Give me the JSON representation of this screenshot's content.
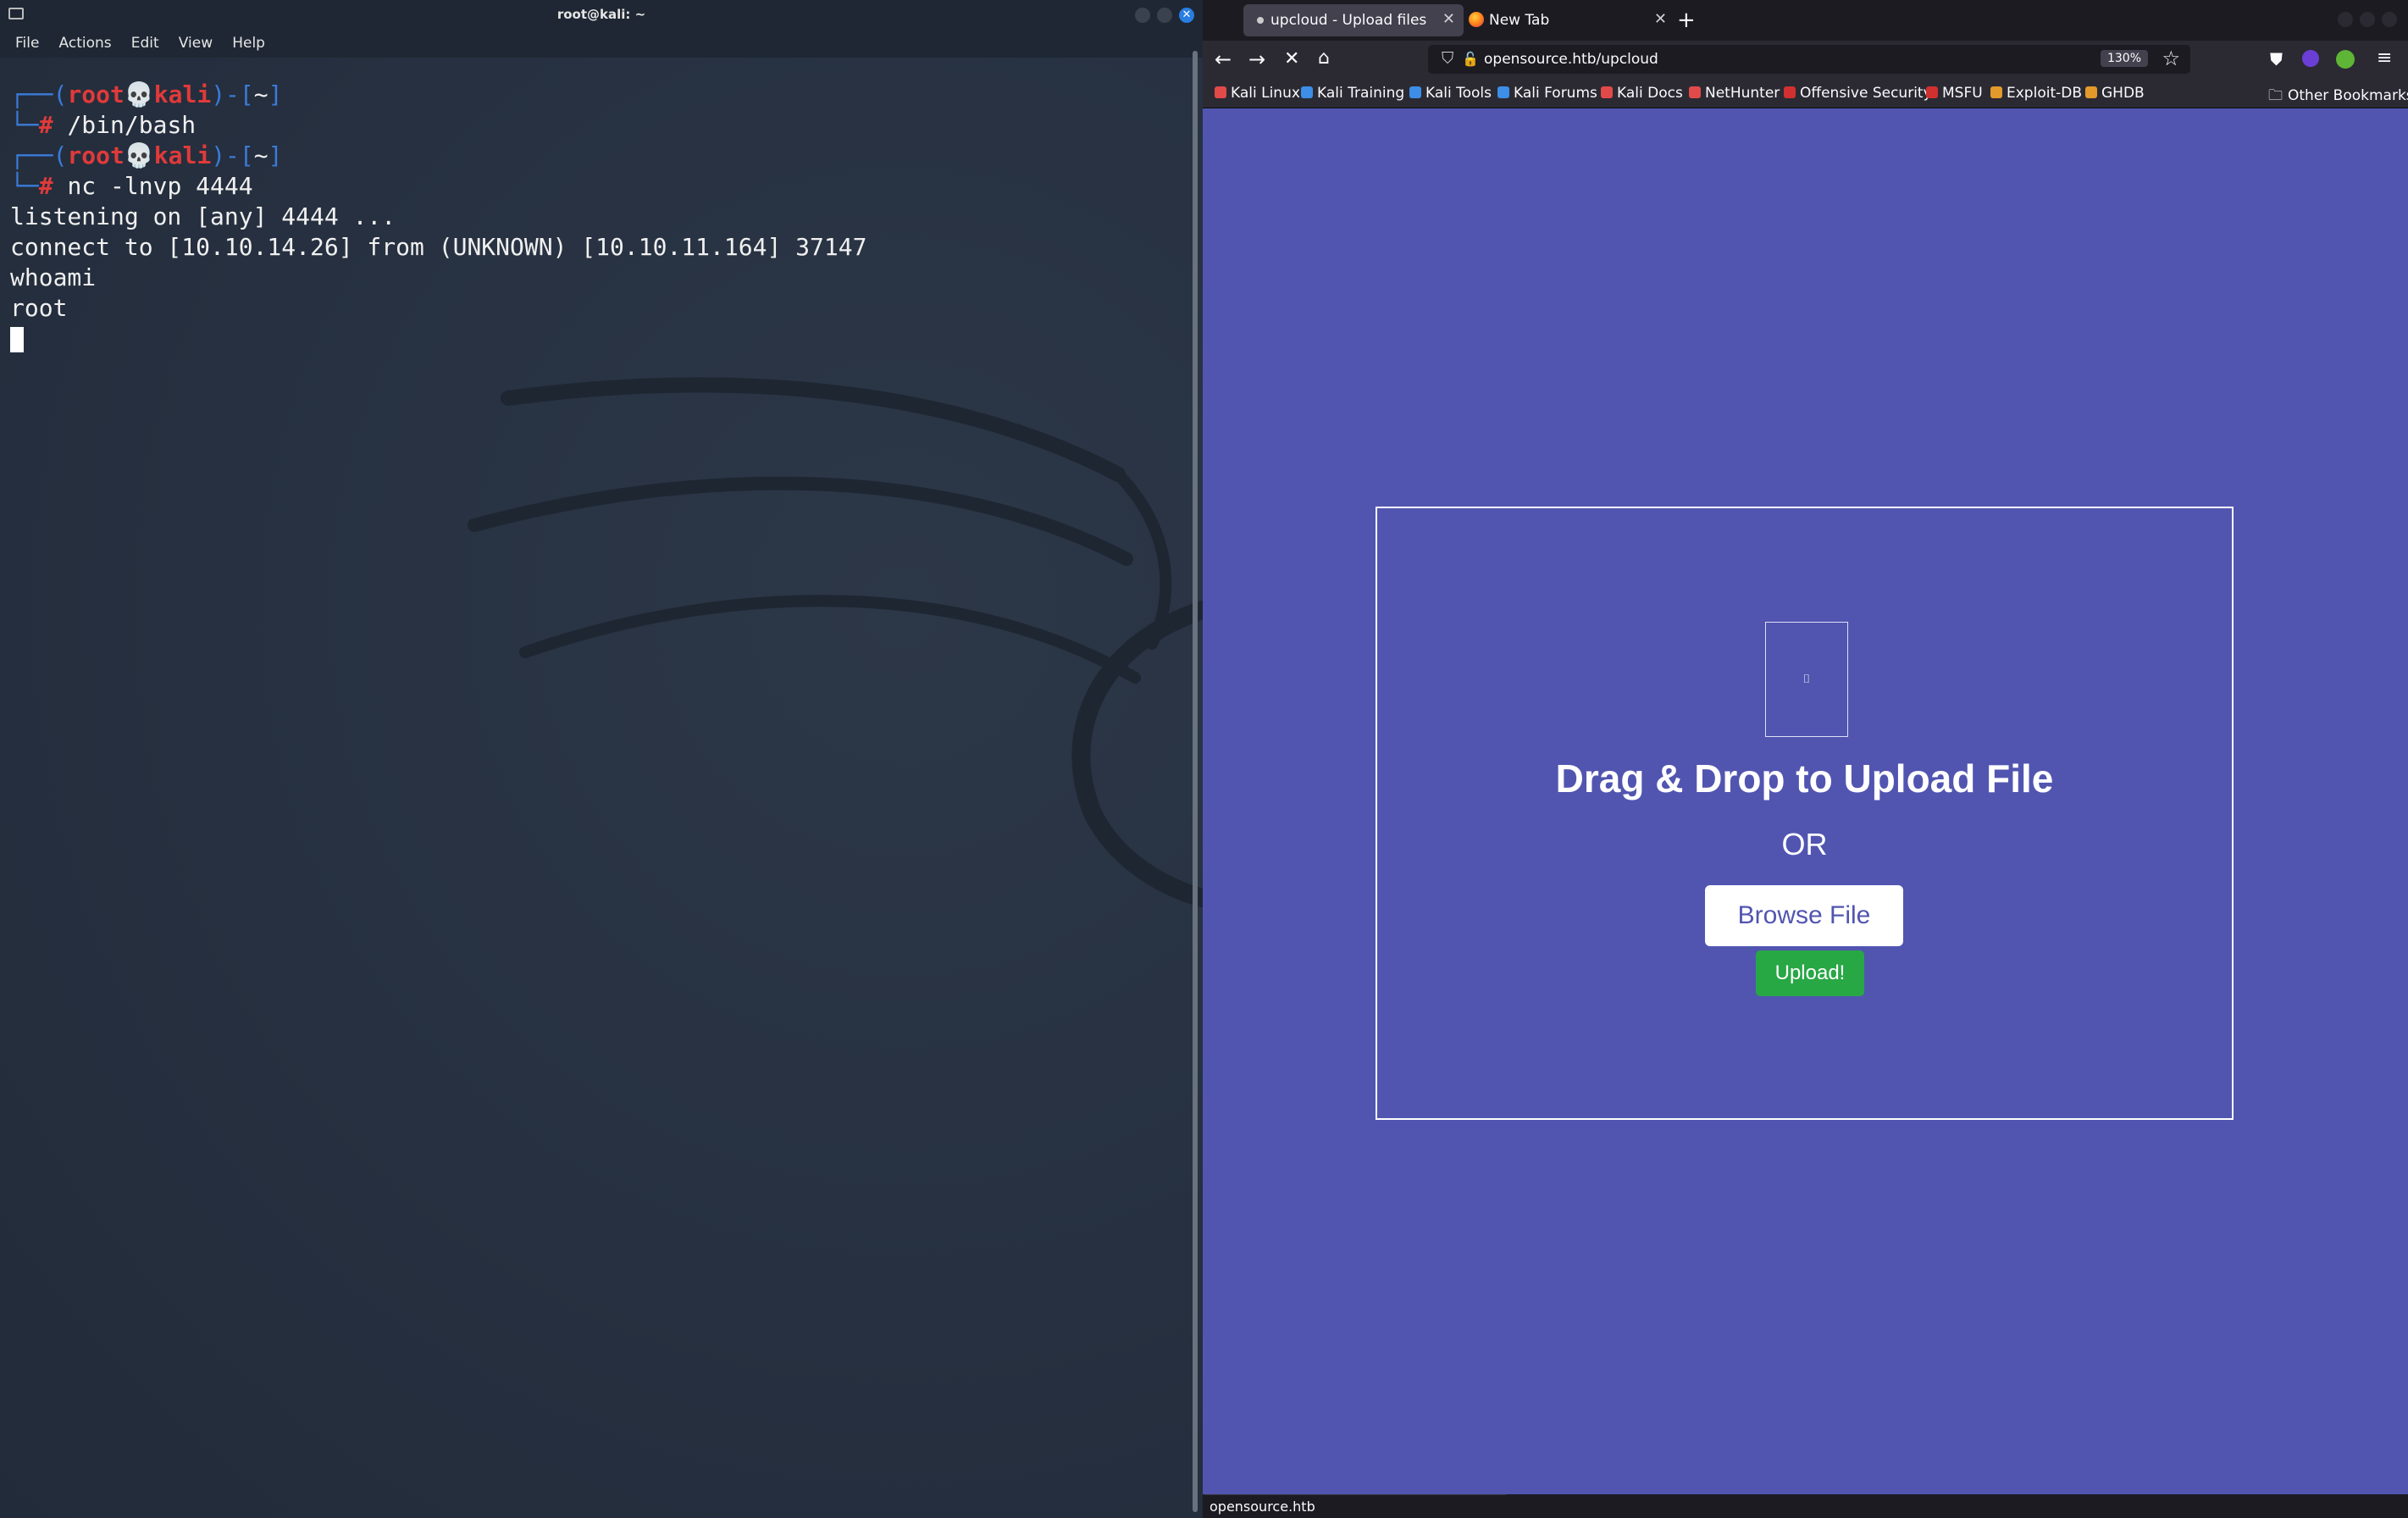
{
  "terminal": {
    "title": "root@kali: ~",
    "menu": [
      "File",
      "Actions",
      "Edit",
      "View",
      "Help"
    ],
    "prompt": {
      "open": "┌──(",
      "user": "root",
      "skull": "💀",
      "host": "kali",
      "close": ")-[",
      "dir": "~",
      "end": "]",
      "hash_prefix": "└─",
      "hash": "#"
    },
    "commands": [
      "/bin/bash",
      "nc -lnvp 4444"
    ],
    "output": [
      "listening on [any] 4444 ...",
      "connect to [10.10.14.26] from (UNKNOWN) [10.10.11.164] 37147",
      "whoami",
      "root"
    ]
  },
  "browser": {
    "tabs": [
      {
        "label": "upcloud - Upload files for",
        "active": true
      },
      {
        "label": "New Tab",
        "active": false
      }
    ],
    "new_tab": "+",
    "url": "opensource.htb/upcloud",
    "zoom": "130%",
    "bookmarks": [
      "Kali Linux",
      "Kali Training",
      "Kali Tools",
      "Kali Forums",
      "Kali Docs",
      "NetHunter",
      "Offensive Security",
      "MSFU",
      "Exploit-DB",
      "GHDB"
    ],
    "other_bookmarks": "Other Bookmarks",
    "status": "opensource.htb"
  },
  "upload": {
    "icon_glyph": "⌷",
    "title": "Drag & Drop to Upload File",
    "or": "OR",
    "browse": "Browse File",
    "submit": "Upload!"
  },
  "colors": {
    "page_bg": "#5155b0",
    "upload_btn": "#28a745",
    "prompt_user": "#e03a3a",
    "prompt_frame": "#3b7bd8"
  }
}
